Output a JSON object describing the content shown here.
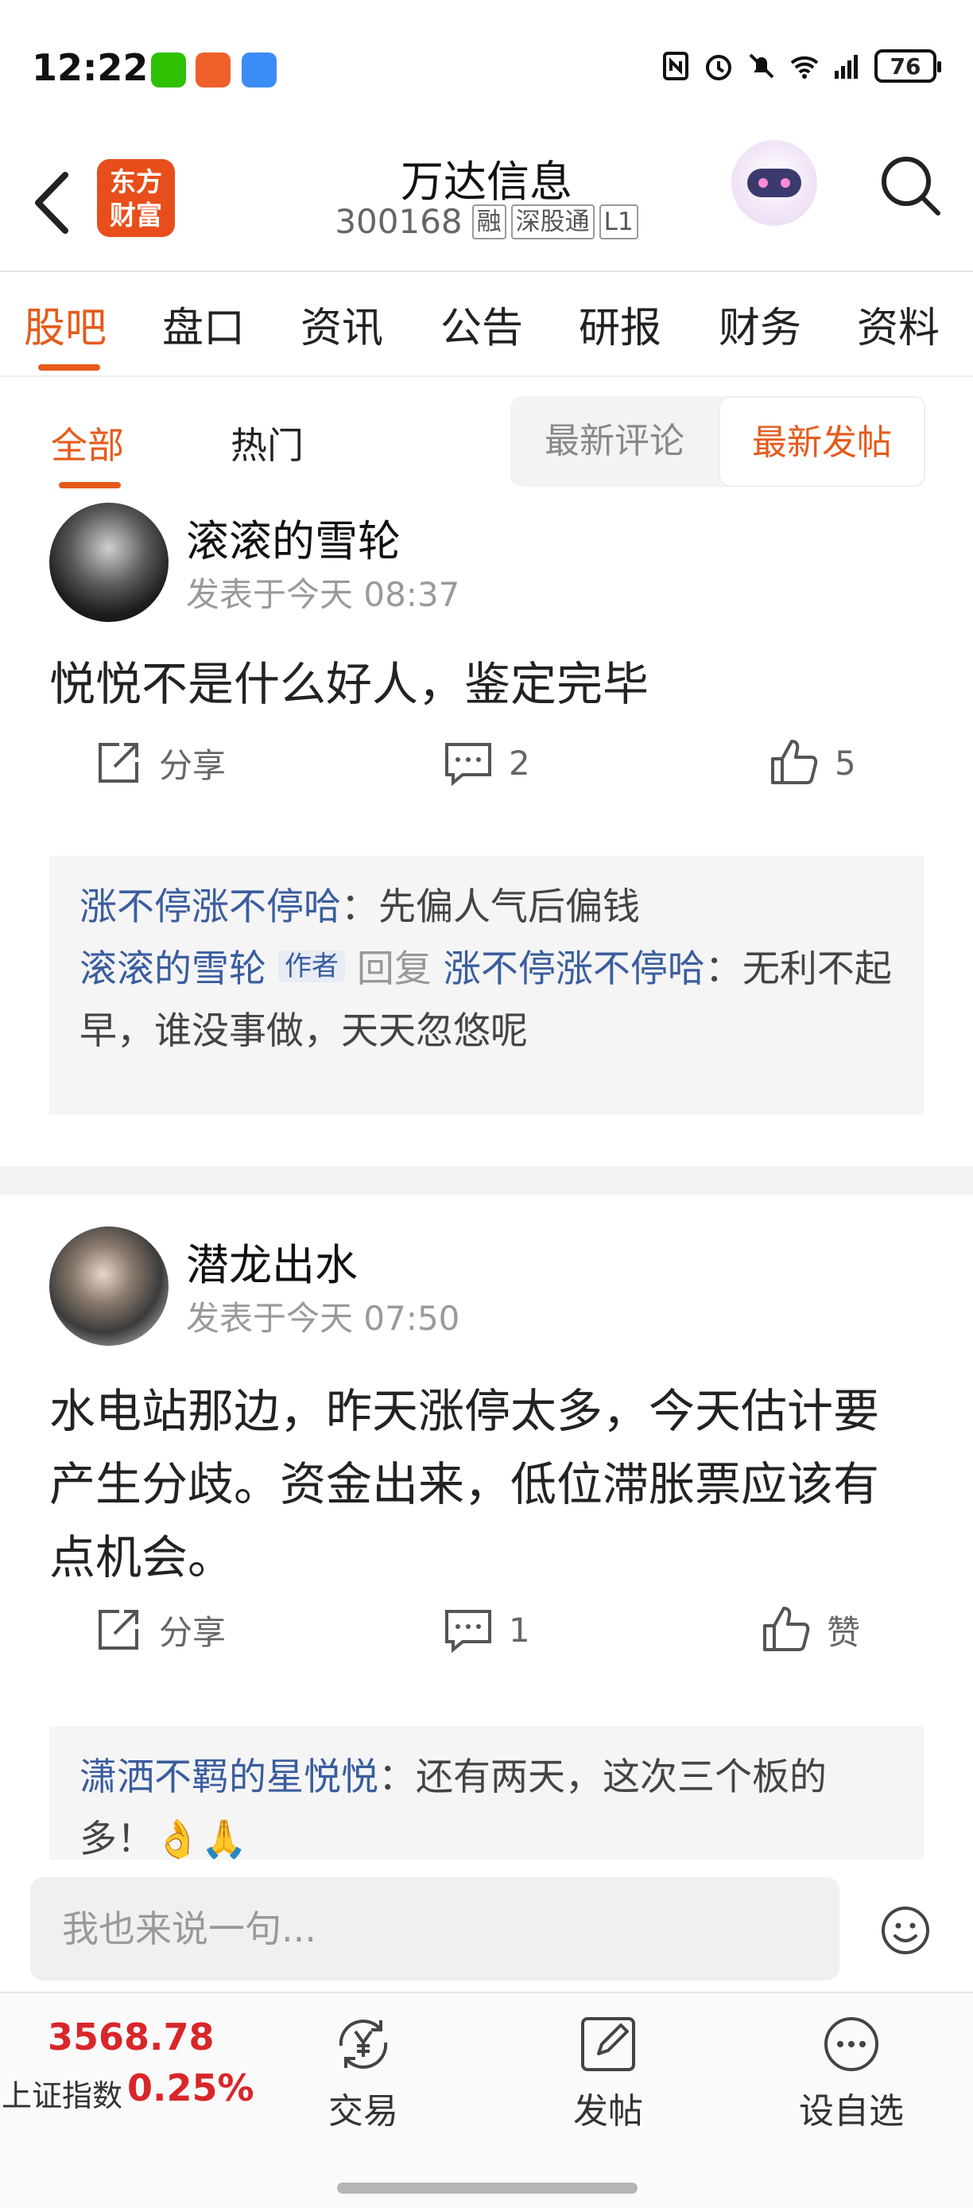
{
  "status_bar": {
    "time": "12:22",
    "battery": "76"
  },
  "header": {
    "stock_name": "万达信息",
    "stock_code": "300168",
    "tags": [
      "融",
      "深股通",
      "L1"
    ],
    "logo_text": "东方\n财富"
  },
  "tabs": [
    {
      "label": "股吧",
      "active": true
    },
    {
      "label": "盘口"
    },
    {
      "label": "资讯"
    },
    {
      "label": "公告"
    },
    {
      "label": "研报"
    },
    {
      "label": "财务"
    },
    {
      "label": "资料"
    }
  ],
  "filter": {
    "left_tabs": [
      {
        "label": "全部",
        "active": true
      },
      {
        "label": "热门"
      }
    ],
    "sort_options": [
      {
        "label": "最新评论"
      },
      {
        "label": "最新发帖",
        "active": true
      }
    ]
  },
  "posts": [
    {
      "author": "滚滚的雪轮",
      "time": "发表于今天 08:37",
      "content": "悦悦不是什么好人，鉴定完毕",
      "share_label": "分享",
      "comment_count": "2",
      "like_count": "5",
      "comments": [
        {
          "user": "涨不停涨不停哈",
          "text": "：先偏人气后偏钱"
        },
        {
          "user": "滚滚的雪轮",
          "badge": "作者",
          "reply_word": "回复",
          "reply_to": "涨不停涨不停哈",
          "text": "：无利不起早，谁没事做，天天忽悠呢"
        }
      ]
    },
    {
      "author": "潜龙出水",
      "time": "发表于今天 07:50",
      "content": "水电站那边，昨天涨停太多，今天估计要产生分歧。资金出来，低位滞胀票应该有点机会。",
      "share_label": "分享",
      "comment_count": "1",
      "like_label": "赞",
      "comments": [
        {
          "user": "潇洒不羁的星悦悦",
          "text": "：还有两天，这次三个板的多！👌🙏"
        }
      ]
    }
  ],
  "input_bar": {
    "placeholder": "我也来说一句..."
  },
  "bottom_bar": {
    "index_value": "3568.78",
    "index_name": "上证指数",
    "index_change": "0.25%",
    "items": [
      {
        "label": "交易"
      },
      {
        "label": "发帖"
      },
      {
        "label": "设自选"
      }
    ]
  },
  "colors": {
    "accent": "#e55b1c",
    "link": "#3a5d9e",
    "rise": "#d8262a"
  }
}
